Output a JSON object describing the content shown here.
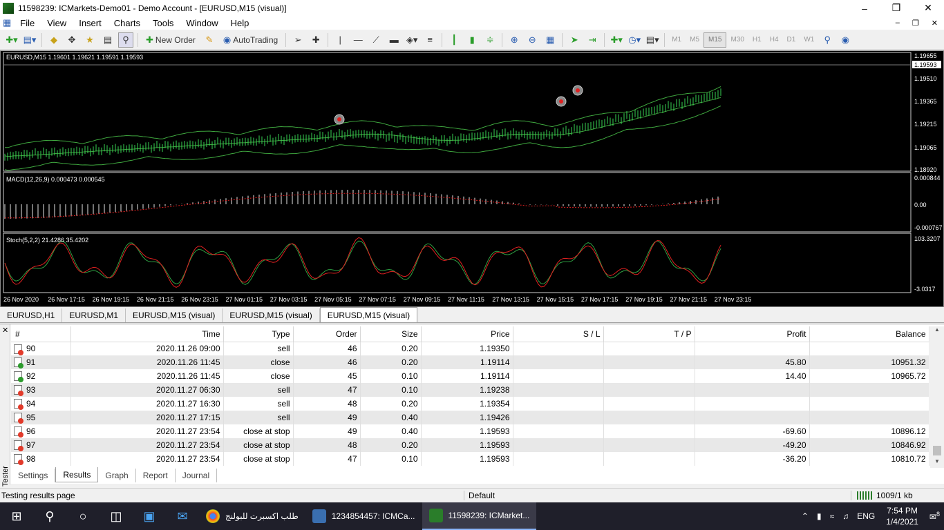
{
  "window": {
    "title": "11598239: ICMarkets-Demo01 - Demo Account - [EURUSD,M15 (visual)]"
  },
  "menu": {
    "items": [
      "File",
      "View",
      "Insert",
      "Charts",
      "Tools",
      "Window",
      "Help"
    ]
  },
  "toolbar": {
    "new_order": "New Order",
    "auto_trading": "AutoTrading",
    "timeframes": [
      "M1",
      "M5",
      "M15",
      "M30",
      "H1",
      "H4",
      "D1",
      "W1"
    ],
    "active_timeframe": "M15"
  },
  "chart": {
    "main_label": "EURUSD,M15  1.19601 1.19621 1.19591 1.19593",
    "price_ticks": [
      "1.19655",
      "1.19510",
      "1.19365",
      "1.19215",
      "1.19065",
      "1.18920"
    ],
    "current_price": "1.19593",
    "macd_label": "MACD(12,26,9) 0.000473 0.000545",
    "macd_ticks": [
      "0.000844",
      "0.00",
      "-0.000767"
    ],
    "stoch_label": "Stoch(5,2,2) 21.4286 35.4202",
    "stoch_ticks": [
      "103.3207",
      "-3.0317"
    ],
    "time_ticks": [
      "26 Nov 2020",
      "26 Nov 17:15",
      "26 Nov 19:15",
      "26 Nov 21:15",
      "26 Nov 23:15",
      "27 Nov 01:15",
      "27 Nov 03:15",
      "27 Nov 05:15",
      "27 Nov 07:15",
      "27 Nov 09:15",
      "27 Nov 11:15",
      "27 Nov 13:15",
      "27 Nov 15:15",
      "27 Nov 17:15",
      "27 Nov 19:15",
      "27 Nov 21:15",
      "27 Nov 23:15"
    ],
    "colors": {
      "candles": "#39d353",
      "bands": "#3fa83f",
      "macd_signal": "#e02020",
      "stoch_main": "#2ea043",
      "stoch_signal": "#e02020"
    }
  },
  "chart_tabs": [
    "EURUSD,H1",
    "EURUSD,M1",
    "EURUSD,M15 (visual)",
    "EURUSD,M15 (visual)",
    "EURUSD,M15 (visual)"
  ],
  "results": {
    "headers": [
      "#",
      "Time",
      "Type",
      "Order",
      "Size",
      "Price",
      "S / L",
      "T / P",
      "Profit",
      "Balance"
    ],
    "rows": [
      {
        "n": "90",
        "time": "2020.11.26 09:00",
        "type": "sell",
        "order": "46",
        "size": "0.20",
        "price": "1.19350",
        "sl": "",
        "tp": "",
        "profit": "",
        "balance": "",
        "icon": "sell"
      },
      {
        "n": "91",
        "time": "2020.11.26 11:45",
        "type": "close",
        "order": "46",
        "size": "0.20",
        "price": "1.19114",
        "sl": "",
        "tp": "",
        "profit": "45.80",
        "balance": "10951.32",
        "icon": "close"
      },
      {
        "n": "92",
        "time": "2020.11.26 11:45",
        "type": "close",
        "order": "45",
        "size": "0.10",
        "price": "1.19114",
        "sl": "",
        "tp": "",
        "profit": "14.40",
        "balance": "10965.72",
        "icon": "close"
      },
      {
        "n": "93",
        "time": "2020.11.27 06:30",
        "type": "sell",
        "order": "47",
        "size": "0.10",
        "price": "1.19238",
        "sl": "",
        "tp": "",
        "profit": "",
        "balance": "",
        "icon": "sell"
      },
      {
        "n": "94",
        "time": "2020.11.27 16:30",
        "type": "sell",
        "order": "48",
        "size": "0.20",
        "price": "1.19354",
        "sl": "",
        "tp": "",
        "profit": "",
        "balance": "",
        "icon": "sell"
      },
      {
        "n": "95",
        "time": "2020.11.27 17:15",
        "type": "sell",
        "order": "49",
        "size": "0.40",
        "price": "1.19426",
        "sl": "",
        "tp": "",
        "profit": "",
        "balance": "",
        "icon": "sell"
      },
      {
        "n": "96",
        "time": "2020.11.27 23:54",
        "type": "close at stop",
        "order": "49",
        "size": "0.40",
        "price": "1.19593",
        "sl": "",
        "tp": "",
        "profit": "-69.60",
        "balance": "10896.12",
        "icon": "stop"
      },
      {
        "n": "97",
        "time": "2020.11.27 23:54",
        "type": "close at stop",
        "order": "48",
        "size": "0.20",
        "price": "1.19593",
        "sl": "",
        "tp": "",
        "profit": "-49.20",
        "balance": "10846.92",
        "icon": "stop"
      },
      {
        "n": "98",
        "time": "2020.11.27 23:54",
        "type": "close at stop",
        "order": "47",
        "size": "0.10",
        "price": "1.19593",
        "sl": "",
        "tp": "",
        "profit": "-36.20",
        "balance": "10810.72",
        "icon": "stop"
      }
    ]
  },
  "tester": {
    "side_label": "Tester",
    "tabs": [
      "Settings",
      "Results",
      "Graph",
      "Report",
      "Journal"
    ],
    "active_tab": "Results"
  },
  "status": {
    "left": "Testing results page",
    "profile": "Default",
    "traffic": "1009/1 kb"
  },
  "taskbar": {
    "apps": [
      {
        "label": "طلب اكسبرت للبولنج",
        "icon_color": "#e8a33d"
      },
      {
        "label": "1234854457: ICMCa...",
        "icon_color": "#3a6fb0"
      },
      {
        "label": "11598239: ICMarket...",
        "icon_color": "#2a7d2a"
      }
    ],
    "lang": "ENG",
    "time": "7:54 PM",
    "date": "1/4/2021",
    "notifications": "8"
  }
}
